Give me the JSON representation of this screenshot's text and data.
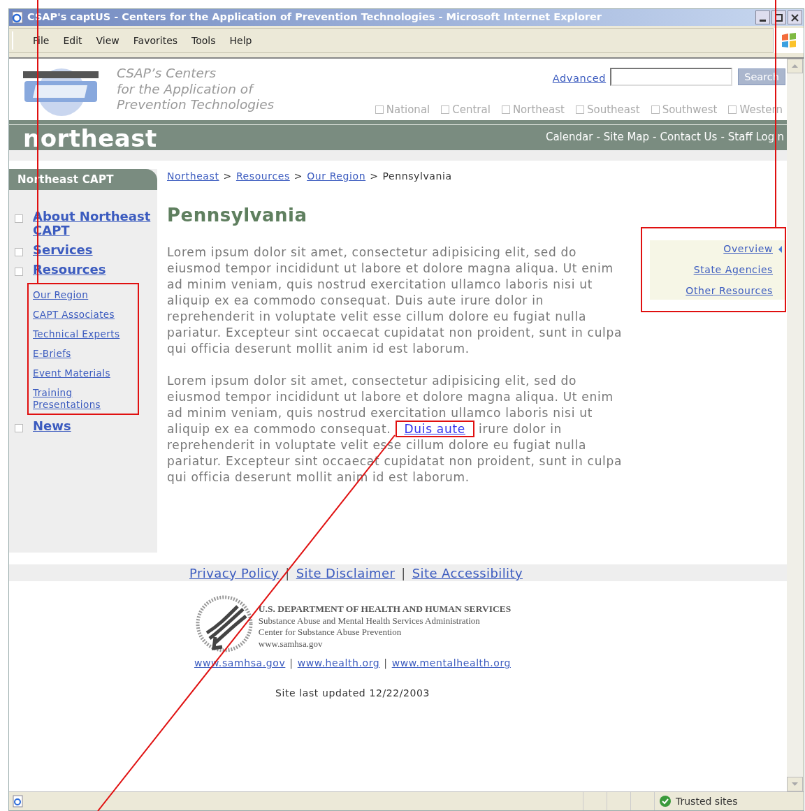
{
  "window": {
    "title": "CSAP's captUS - Centers for the Application of Prevention Technologies - Microsoft Internet Explorer"
  },
  "menu": [
    "File",
    "Edit",
    "View",
    "Favorites",
    "Tools",
    "Help"
  ],
  "header": {
    "tagline": [
      "CSAP’s Centers",
      "for the Application of",
      "Prevention Technologies"
    ],
    "advanced_link": "Advanced",
    "search_button": "Search",
    "regions": [
      {
        "label": "National",
        "checked": false
      },
      {
        "label": "Central",
        "checked": false
      },
      {
        "label": "Northeast",
        "checked": false
      },
      {
        "label": "Southeast",
        "checked": false
      },
      {
        "label": "Southwest",
        "checked": false
      },
      {
        "label": "Western",
        "checked": false
      }
    ]
  },
  "band": {
    "title": "northeast",
    "separator": "-",
    "links": [
      "Calendar",
      "Site Map",
      "Contact Us",
      "Staff Login"
    ]
  },
  "sidebar": {
    "heading": "Northeast CAPT",
    "items": [
      {
        "label": "About Northeast CAPT",
        "checked": false
      },
      {
        "label": "Services",
        "checked": false
      },
      {
        "label": "Resources",
        "checked": false,
        "children": [
          "Our Region",
          "CAPT Associates",
          "Technical Experts",
          "E-Briefs",
          "Event Materials",
          "Training Presentations"
        ]
      },
      {
        "label": "News",
        "checked": false
      }
    ]
  },
  "breadcrumb": {
    "separator": ">",
    "links": [
      "Northeast",
      "Resources",
      "Our Region"
    ],
    "current": "Pennsylvania"
  },
  "page_title": "Pennsylvania",
  "paragraphs": [
    {
      "text": "Lorem ipsum dolor sit amet, consectetur adipisicing elit, sed do eiusmod tempor incididunt ut labore et dolore magna aliqua. Ut enim ad minim veniam, quis nostrud exercitation ullamco laboris nisi ut aliquip ex ea commodo consequat. Duis aute irure dolor in reprehenderit in voluptate velit esse cillum dolore eu fugiat nulla pariatur. Excepteur sint occaecat cupidatat non proident, sunt in culpa qui officia deserunt mollit anim id est laborum."
    },
    {
      "text": "Lorem ipsum dolor sit amet, consectetur adipisicing elit, sed do eiusmod tempor incididunt ut labore et dolore magna aliqua. Ut enim ad minim veniam, quis nostrud exercitation ullamco laboris nisi ut aliquip ex ea commodo consequat.",
      "link": "Duis aute",
      "after": "irure dolor in reprehenderit in voluptate velit esse cillum dolore eu fugiat nulla pariatur. Excepteur sint occaecat cupidatat non proident, sunt in culpa qui officia deserunt mollit anim id est laborum."
    }
  ],
  "local_nav": [
    {
      "label": "Overview",
      "selected": true
    },
    {
      "label": "State Agencies",
      "selected": false
    },
    {
      "label": "Other Resources",
      "selected": false
    }
  ],
  "footer": {
    "separator": "|",
    "links": [
      "Privacy Policy",
      "Site Disclaimer",
      "Site Accessibility"
    ],
    "agency": [
      "U.S. DEPARTMENT OF HEALTH AND HUMAN SERVICES",
      "Substance Abuse and Mental Health Services Administration",
      "Center for Substance Abuse Prevention",
      "www.samhsa.gov"
    ],
    "sites": [
      "www.samhsa.gov",
      "www.health.org",
      "www.mentalhealth.org"
    ],
    "updated": "Site last updated 12/22/2003"
  },
  "status_bar": {
    "zone": "Trusted sites"
  }
}
